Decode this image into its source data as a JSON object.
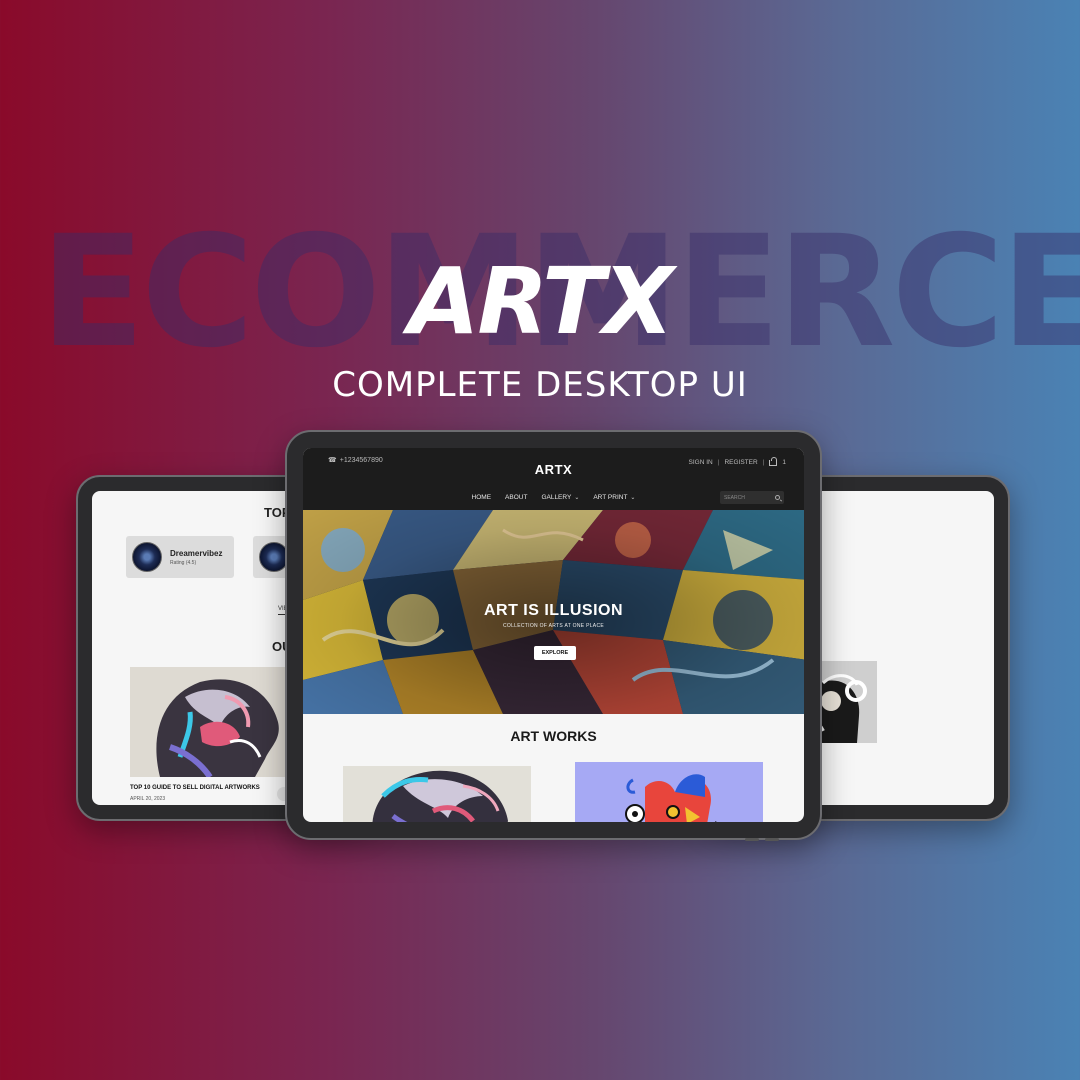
{
  "background": {
    "watermark": "ECOMMERCE",
    "gradient_left": "#8a0a2a",
    "gradient_right": "#4a82b4"
  },
  "headline": {
    "brand": "ARTX",
    "tagline": "COMPLETE DESKTOP UI"
  },
  "left_screen": {
    "heading_partial": "TOP",
    "artist_card": {
      "name": "Dreamervibez",
      "rating": "Rating (4.5)"
    },
    "view_partial": "VIE",
    "heading2_partial": "OU",
    "blog": {
      "title": "TOP 10 GUIDE TO SELL DIGITAL ARTWORKS",
      "date": "APRIL 20, 2023"
    }
  },
  "center_screen": {
    "header": {
      "phone": "+1234567890",
      "logo": "ARTX",
      "sign_in": "SIGN IN",
      "separator": "|",
      "register": "REGISTER",
      "cart_count": "1"
    },
    "nav": {
      "home": "HOME",
      "about": "ABOUT",
      "gallery": "GALLERY",
      "art_print": "ART PRINT"
    },
    "search": {
      "placeholder": "SEARCH"
    },
    "hero": {
      "title": "ART IS ILLUSION",
      "subtitle": "COLLECTION OF ARTS AT ONE PLACE",
      "button": "EXPLORE"
    },
    "artworks": {
      "title": "ART WORKS"
    }
  },
  "icons": [
    "phone-icon",
    "cart-icon",
    "chevron-down-icon",
    "search-icon"
  ],
  "colors": {
    "header_bg": "#1c1c1c",
    "screen_bg": "#f6f6f6",
    "accent_purple": "#a6a9f4"
  }
}
